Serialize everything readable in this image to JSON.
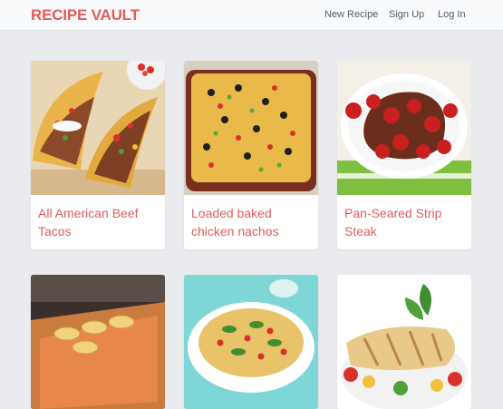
{
  "navbar": {
    "brand": "RECIPE VAULT",
    "links": [
      "New Recipe",
      "Sign Up",
      "Log In"
    ]
  },
  "recipes": [
    {
      "title": "All American Beef Tacos",
      "image": "tacos"
    },
    {
      "title": "Loaded baked chicken nachos",
      "image": "nachos"
    },
    {
      "title": "Pan-Seared Strip Steak",
      "image": "steak"
    },
    {
      "title": "",
      "image": "salmon"
    },
    {
      "title": "",
      "image": "pasta-salad"
    },
    {
      "title": "",
      "image": "grilled-chicken"
    }
  ],
  "colors": {
    "brand": "#e05c5c",
    "background": "#e9ebee",
    "navbar": "#f8f9fa"
  }
}
